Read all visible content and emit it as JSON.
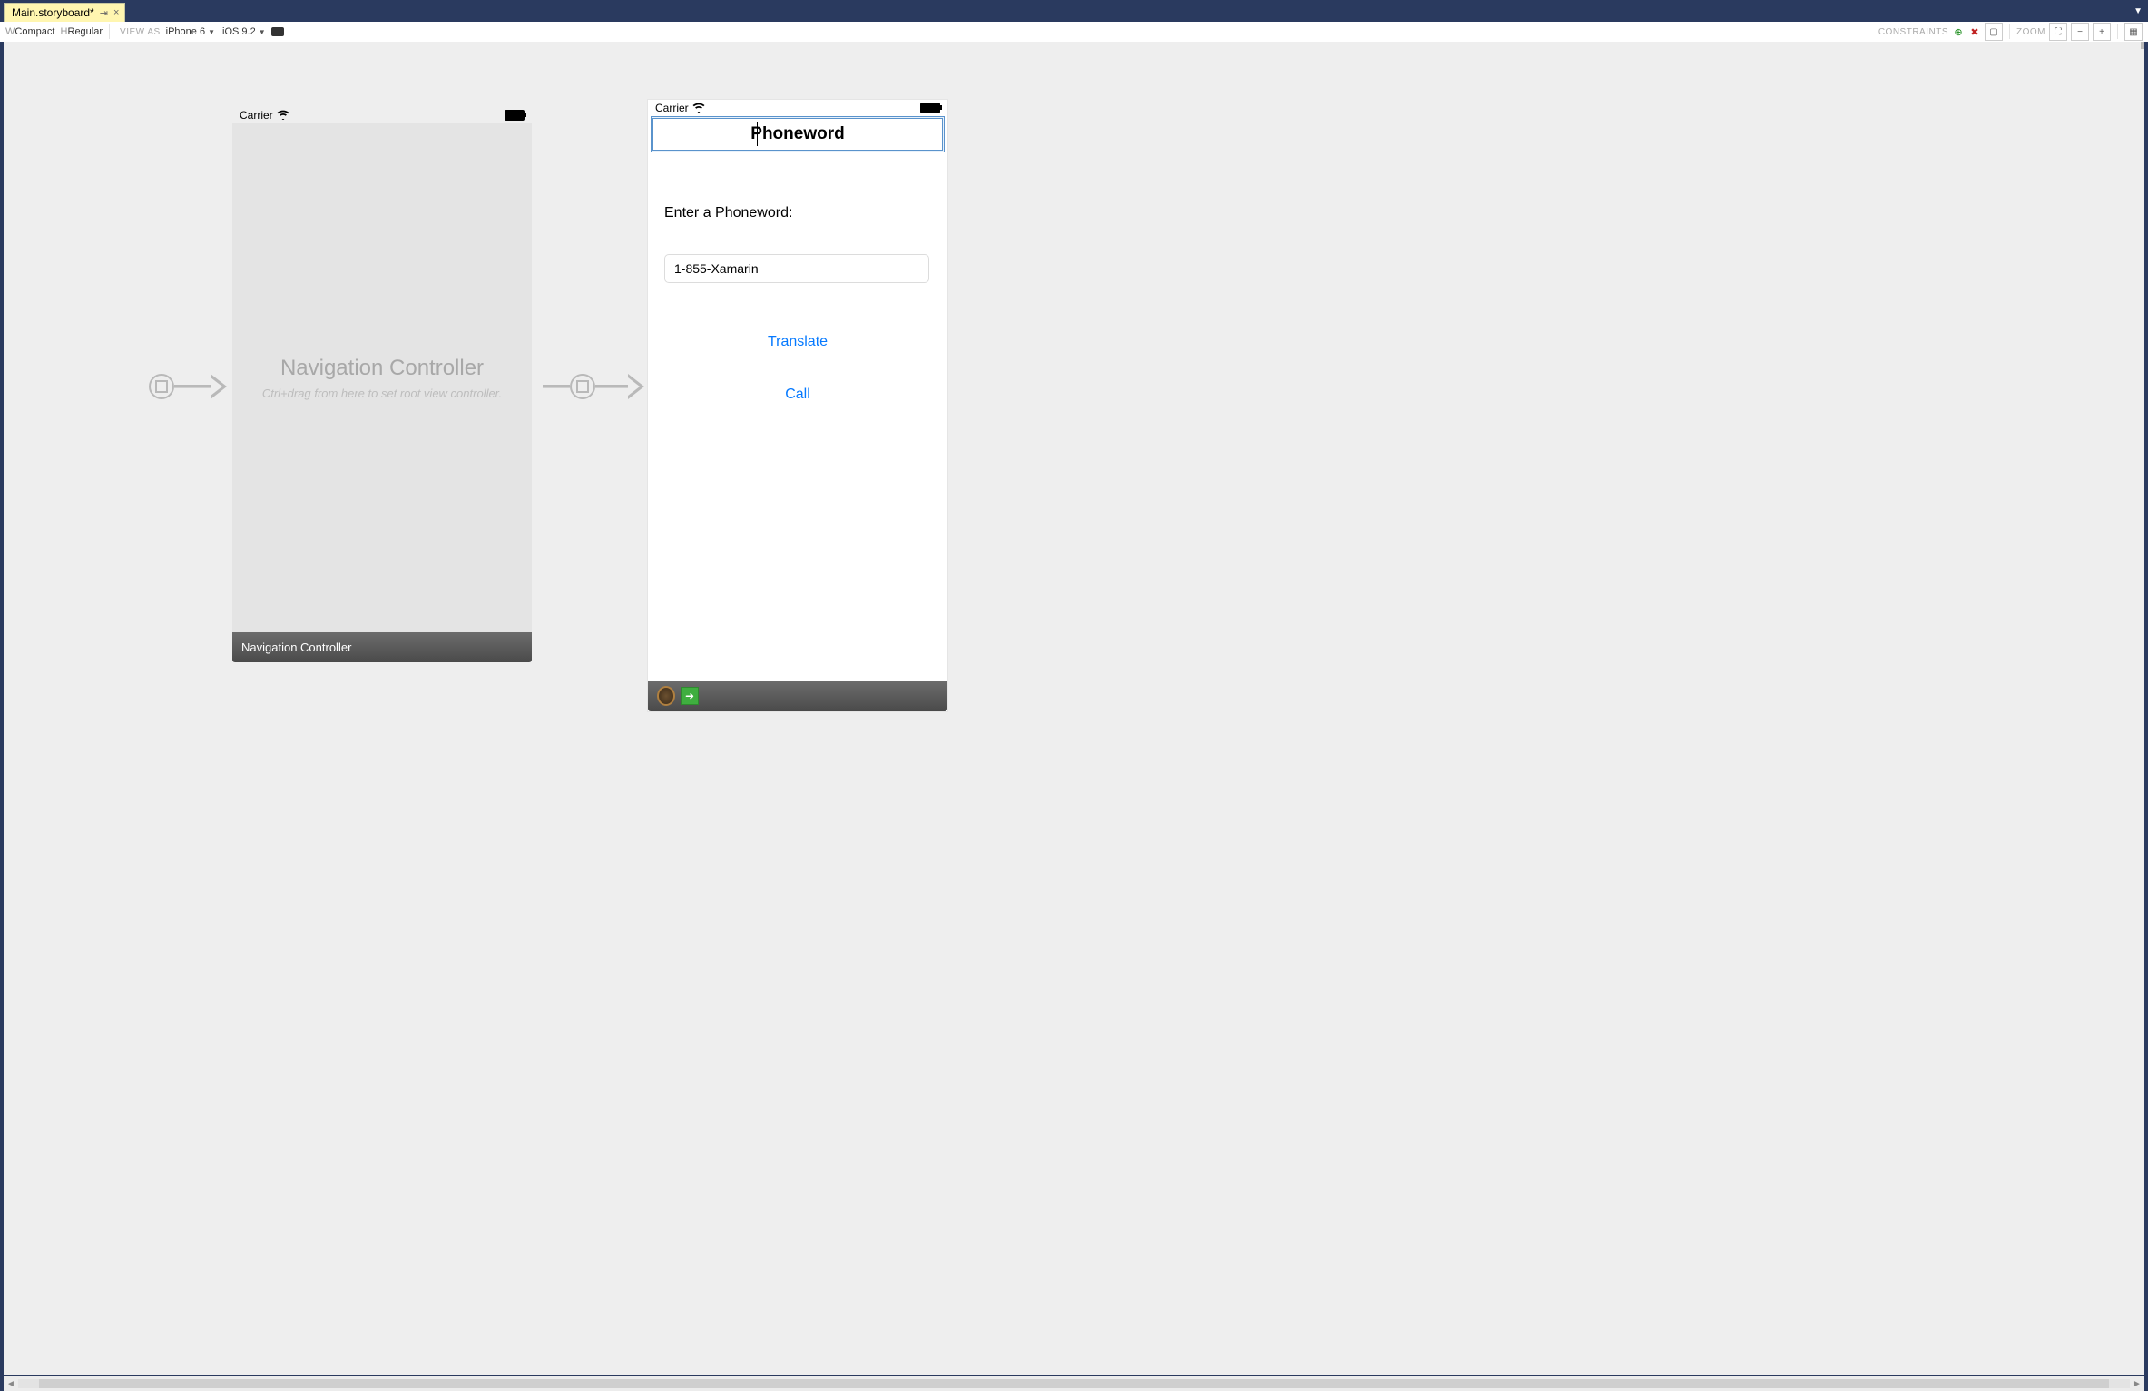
{
  "tab": {
    "title": "Main.storyboard*",
    "pin_glyph": "⇥",
    "close_glyph": "×"
  },
  "toolbar": {
    "size_w_label": "W",
    "size_w_value": "Compact",
    "size_h_label": "H",
    "size_h_value": "Regular",
    "view_as_label": "VIEW AS",
    "device": "iPhone 6",
    "ios_version": "iOS 9.2",
    "constraints_label": "CONSTRAINTS",
    "zoom_label": "ZOOM"
  },
  "arrows": {
    "entry": "entry-point",
    "root": "root-segue"
  },
  "nav_scene": {
    "carrier": "Carrier",
    "title": "Navigation Controller",
    "hint": "Ctrl+drag from here to set root view controller.",
    "footer": "Navigation Controller"
  },
  "vc_scene": {
    "carrier": "Carrier",
    "nav_title": "Phoneword",
    "label": "Enter a Phoneword:",
    "textfield_value": "1-855-Xamarin",
    "translate": "Translate",
    "call": "Call"
  }
}
